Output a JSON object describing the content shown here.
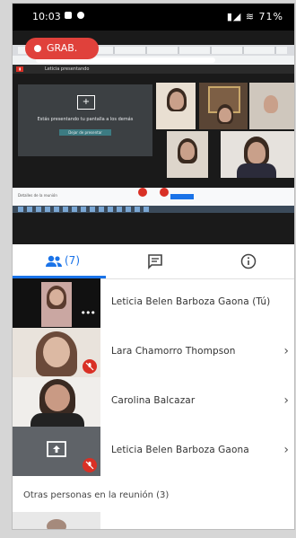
{
  "status_bar": {
    "time": "10:03",
    "battery": "71%"
  },
  "recording_badge": {
    "label": "GRAB."
  },
  "shared_screen": {
    "present_text": "Estás presentando tu pantalla a los demás",
    "present_button": "Dejar de presentar",
    "presenter_label": "Leticia presentando",
    "details_label": "Detalles de la reunión"
  },
  "tabs": {
    "people_count": "(7)"
  },
  "participants": [
    {
      "name": "Leticia Belen Barboza Gaona (Tú)",
      "has_chevron": false
    },
    {
      "name": "Lara Chamorro Thompson",
      "has_chevron": true
    },
    {
      "name": "Carolina Balcazar",
      "has_chevron": true
    },
    {
      "name": "Leticia Belen Barboza Gaona",
      "has_chevron": true
    }
  ],
  "others_heading": "Otras personas en la reunión (3)",
  "colors": {
    "accent": "#1a73e8",
    "mute_red": "#d93025",
    "record_red": "#e0413b"
  }
}
